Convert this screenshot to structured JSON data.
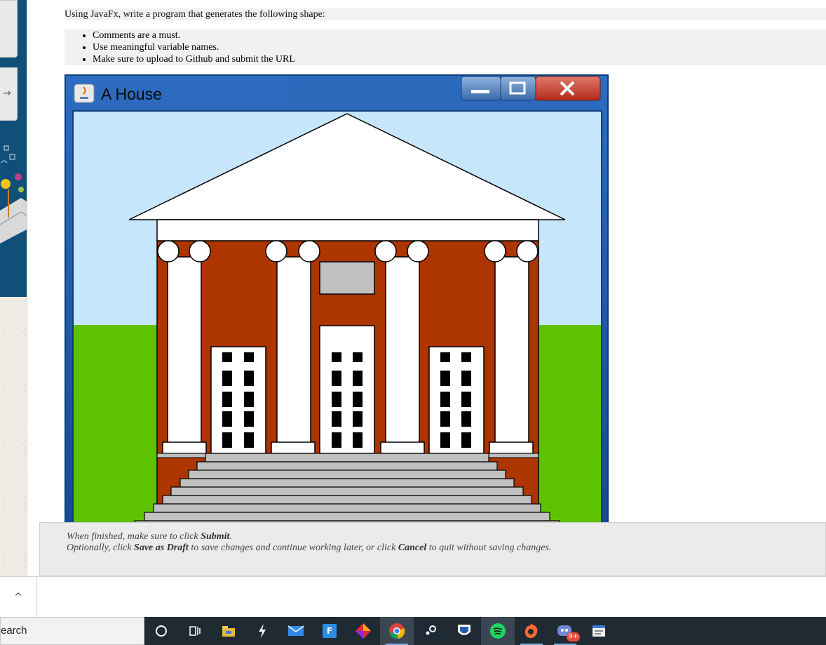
{
  "assignment": {
    "prompt": "Using JavaFx, write a program that generates the following shape:",
    "bullets": [
      "Comments are a must.",
      "Use meaningful variable names.",
      "Make sure to upload to Github and submit the URL"
    ]
  },
  "embedded_window": {
    "title": "A House",
    "colors": {
      "sky": "#c6e6fb",
      "grass": "#5dc300",
      "brick": "#ad3500",
      "frame": "#1d5aa6"
    }
  },
  "footer": {
    "line1_pre": "When finished, make sure to click ",
    "line1_bold": "Submit",
    "line1_post": ".",
    "line2_a": "Optionally, click ",
    "line2_b": "Save as Draft",
    "line2_c": " to save changes and continue working later, or click ",
    "line2_d": "Cancel",
    "line2_e": " to quit without saving changes."
  },
  "left_panel": {
    "arrow": "→",
    "expand": "^"
  },
  "taskbar": {
    "search_text": "earch",
    "icons": [
      "cortana-icon",
      "task-view-icon",
      "file-explorer-icon",
      "app-lightning-icon",
      "mail-icon",
      "app-f-icon",
      "app-diamond-icon",
      "chrome-icon",
      "steam-icon",
      "rocket-league-icon",
      "spotify-icon",
      "origin-icon",
      "discord-icon",
      "app-window-icon"
    ],
    "discord_badge": "9+"
  }
}
